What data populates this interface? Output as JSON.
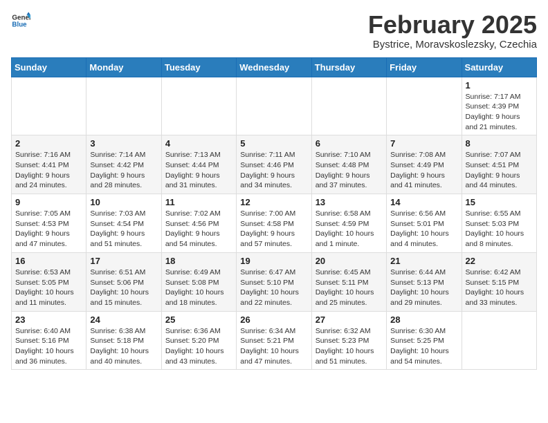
{
  "header": {
    "logo_general": "General",
    "logo_blue": "Blue",
    "title": "February 2025",
    "subtitle": "Bystrice, Moravskoslezsky, Czechia"
  },
  "weekdays": [
    "Sunday",
    "Monday",
    "Tuesday",
    "Wednesday",
    "Thursday",
    "Friday",
    "Saturday"
  ],
  "weeks": [
    [
      {
        "day": "",
        "info": ""
      },
      {
        "day": "",
        "info": ""
      },
      {
        "day": "",
        "info": ""
      },
      {
        "day": "",
        "info": ""
      },
      {
        "day": "",
        "info": ""
      },
      {
        "day": "",
        "info": ""
      },
      {
        "day": "1",
        "info": "Sunrise: 7:17 AM\nSunset: 4:39 PM\nDaylight: 9 hours and 21 minutes."
      }
    ],
    [
      {
        "day": "2",
        "info": "Sunrise: 7:16 AM\nSunset: 4:41 PM\nDaylight: 9 hours and 24 minutes."
      },
      {
        "day": "3",
        "info": "Sunrise: 7:14 AM\nSunset: 4:42 PM\nDaylight: 9 hours and 28 minutes."
      },
      {
        "day": "4",
        "info": "Sunrise: 7:13 AM\nSunset: 4:44 PM\nDaylight: 9 hours and 31 minutes."
      },
      {
        "day": "5",
        "info": "Sunrise: 7:11 AM\nSunset: 4:46 PM\nDaylight: 9 hours and 34 minutes."
      },
      {
        "day": "6",
        "info": "Sunrise: 7:10 AM\nSunset: 4:48 PM\nDaylight: 9 hours and 37 minutes."
      },
      {
        "day": "7",
        "info": "Sunrise: 7:08 AM\nSunset: 4:49 PM\nDaylight: 9 hours and 41 minutes."
      },
      {
        "day": "8",
        "info": "Sunrise: 7:07 AM\nSunset: 4:51 PM\nDaylight: 9 hours and 44 minutes."
      }
    ],
    [
      {
        "day": "9",
        "info": "Sunrise: 7:05 AM\nSunset: 4:53 PM\nDaylight: 9 hours and 47 minutes."
      },
      {
        "day": "10",
        "info": "Sunrise: 7:03 AM\nSunset: 4:54 PM\nDaylight: 9 hours and 51 minutes."
      },
      {
        "day": "11",
        "info": "Sunrise: 7:02 AM\nSunset: 4:56 PM\nDaylight: 9 hours and 54 minutes."
      },
      {
        "day": "12",
        "info": "Sunrise: 7:00 AM\nSunset: 4:58 PM\nDaylight: 9 hours and 57 minutes."
      },
      {
        "day": "13",
        "info": "Sunrise: 6:58 AM\nSunset: 4:59 PM\nDaylight: 10 hours and 1 minute."
      },
      {
        "day": "14",
        "info": "Sunrise: 6:56 AM\nSunset: 5:01 PM\nDaylight: 10 hours and 4 minutes."
      },
      {
        "day": "15",
        "info": "Sunrise: 6:55 AM\nSunset: 5:03 PM\nDaylight: 10 hours and 8 minutes."
      }
    ],
    [
      {
        "day": "16",
        "info": "Sunrise: 6:53 AM\nSunset: 5:05 PM\nDaylight: 10 hours and 11 minutes."
      },
      {
        "day": "17",
        "info": "Sunrise: 6:51 AM\nSunset: 5:06 PM\nDaylight: 10 hours and 15 minutes."
      },
      {
        "day": "18",
        "info": "Sunrise: 6:49 AM\nSunset: 5:08 PM\nDaylight: 10 hours and 18 minutes."
      },
      {
        "day": "19",
        "info": "Sunrise: 6:47 AM\nSunset: 5:10 PM\nDaylight: 10 hours and 22 minutes."
      },
      {
        "day": "20",
        "info": "Sunrise: 6:45 AM\nSunset: 5:11 PM\nDaylight: 10 hours and 25 minutes."
      },
      {
        "day": "21",
        "info": "Sunrise: 6:44 AM\nSunset: 5:13 PM\nDaylight: 10 hours and 29 minutes."
      },
      {
        "day": "22",
        "info": "Sunrise: 6:42 AM\nSunset: 5:15 PM\nDaylight: 10 hours and 33 minutes."
      }
    ],
    [
      {
        "day": "23",
        "info": "Sunrise: 6:40 AM\nSunset: 5:16 PM\nDaylight: 10 hours and 36 minutes."
      },
      {
        "day": "24",
        "info": "Sunrise: 6:38 AM\nSunset: 5:18 PM\nDaylight: 10 hours and 40 minutes."
      },
      {
        "day": "25",
        "info": "Sunrise: 6:36 AM\nSunset: 5:20 PM\nDaylight: 10 hours and 43 minutes."
      },
      {
        "day": "26",
        "info": "Sunrise: 6:34 AM\nSunset: 5:21 PM\nDaylight: 10 hours and 47 minutes."
      },
      {
        "day": "27",
        "info": "Sunrise: 6:32 AM\nSunset: 5:23 PM\nDaylight: 10 hours and 51 minutes."
      },
      {
        "day": "28",
        "info": "Sunrise: 6:30 AM\nSunset: 5:25 PM\nDaylight: 10 hours and 54 minutes."
      },
      {
        "day": "",
        "info": ""
      }
    ]
  ]
}
